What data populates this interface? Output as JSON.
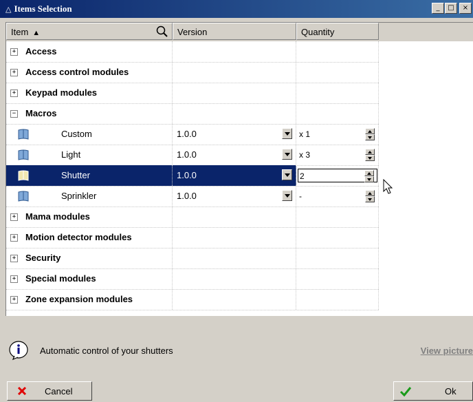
{
  "window": {
    "title": "Items Selection",
    "buttons": [
      "_",
      "□",
      "×"
    ]
  },
  "columns": {
    "item": "Item",
    "version": "Version",
    "quantity": "Quantity"
  },
  "rows": [
    {
      "type": "group",
      "label": "Access",
      "expanded": false
    },
    {
      "type": "group",
      "label": "Access control modules",
      "expanded": false
    },
    {
      "type": "group",
      "label": "Keypad modules",
      "expanded": false
    },
    {
      "type": "group",
      "label": "Macros",
      "expanded": true
    },
    {
      "type": "item",
      "label": "Custom",
      "version": "1.0.0",
      "quantity": "x 1",
      "icon": "custom-macro-icon"
    },
    {
      "type": "item",
      "label": "Light",
      "version": "1.0.0",
      "quantity": "x 3",
      "icon": "light-macro-icon"
    },
    {
      "type": "item",
      "label": "Shutter",
      "version": "1.0.0",
      "quantity": "2",
      "icon": "shutter-macro-icon",
      "selected": true
    },
    {
      "type": "item",
      "label": "Sprinkler",
      "version": "1.0.0",
      "quantity": "-",
      "icon": "sprinkler-macro-icon"
    },
    {
      "type": "group",
      "label": "Mama modules",
      "expanded": false
    },
    {
      "type": "group",
      "label": "Motion detector modules",
      "expanded": false
    },
    {
      "type": "group",
      "label": "Security",
      "expanded": false
    },
    {
      "type": "group",
      "label": "Special modules",
      "expanded": false
    },
    {
      "type": "group",
      "label": "Zone expansion modules",
      "expanded": false
    }
  ],
  "status": {
    "text": "Automatic control of your shutters",
    "link": "View picture"
  },
  "buttons": {
    "cancel": "Cancel",
    "ok": "Ok"
  },
  "colors": {
    "title_bar": "#0a246a",
    "selection": "#0a246a",
    "background": "#d4d0c8"
  }
}
